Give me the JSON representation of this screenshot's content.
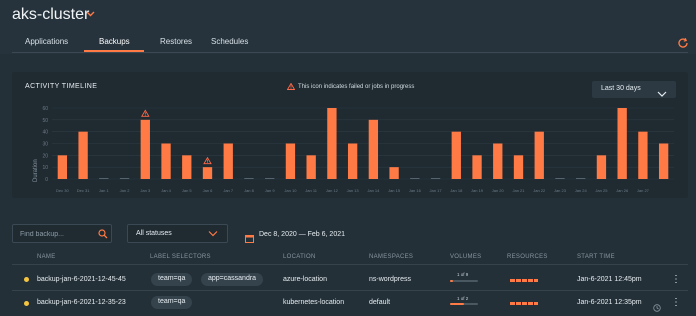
{
  "app": {
    "title": "aks-cluster"
  },
  "tabs": [
    {
      "label": "Applications"
    },
    {
      "label": "Backups"
    },
    {
      "label": "Restores"
    },
    {
      "label": "Schedules"
    }
  ],
  "activity": {
    "title": "ACTIVITY TIMELINE",
    "legend_text": "This icon indicates failed or jobs in progress",
    "range_value": "Last 30 days"
  },
  "chart_data": {
    "type": "bar",
    "ylabel": "Duration",
    "ylim": [
      0,
      60
    ],
    "yticks": [
      0,
      10,
      20,
      30,
      40,
      50,
      60
    ],
    "grid": true,
    "categories": [
      "Dec 30",
      "Dec 31",
      "Jan 1",
      "Jan 2",
      "Jan 3",
      "Jan 4",
      "Jan 5",
      "Jan 6",
      "Jan 7",
      "Jan 8",
      "Jan 9",
      "Jan 10",
      "Jan 11",
      "Jan 12",
      "Jan 13",
      "Jan 14",
      "Jan 15",
      "Jan 16",
      "Jan 17",
      "Jan 18",
      "Jan 19",
      "Jan 20",
      "Jan 21",
      "Jan 22",
      "Jan 23",
      "Jan 24",
      "Jan 25",
      "Jan 26",
      "Jan 27"
    ],
    "values": [
      20,
      40,
      0,
      0,
      50,
      30,
      20,
      10,
      30,
      0,
      0,
      30,
      20,
      60,
      30,
      50,
      10,
      0,
      0,
      40,
      20,
      30,
      20,
      40,
      0,
      0,
      20,
      60,
      40,
      30
    ],
    "warning_categories": [
      "Jan 3",
      "Jan 6"
    ],
    "bar_color": "#ff7a45",
    "warning_color": "#ff6b4a"
  },
  "filters": {
    "search_placeholder": "Find backup...",
    "status_value": "All statuses",
    "date_range": "Dec 8, 2020 — Feb 6, 2021"
  },
  "table": {
    "headers": [
      "NAME",
      "LABEL SELECTORS",
      "LOCATION",
      "NAMESPACES",
      "VOLUMES",
      "RESOURCES",
      "START TIME"
    ],
    "rows": [
      {
        "name": "backup-jan-6-2021-12-45-45",
        "labels": [
          "team=qa",
          "app=cassandra"
        ],
        "location": "azure-location",
        "namespaces": "ns-wordpress",
        "volumes_text": "1 of 9",
        "volumes_fraction": 0.11,
        "start_time": "Jan-6-2021 12:45pm",
        "status_color": "#f5c542"
      },
      {
        "name": "backup-jan-6-2021-12-35-23",
        "labels": [
          "team=qa"
        ],
        "location": "kubernetes-location",
        "namespaces": "default",
        "volumes_text": "1 of 2",
        "volumes_fraction": 0.5,
        "start_time": "Jan-6-2021 12:35pm",
        "status_color": "#f5c542"
      }
    ]
  },
  "colors": {
    "accent": "#ff7a45",
    "background": "#243038",
    "panel": "#1f2a31"
  },
  "icons": [
    "chevron-down-icon",
    "refresh-icon",
    "warning-icon",
    "search-icon",
    "calendar-icon",
    "clock-icon",
    "kebab-menu-icon"
  ]
}
